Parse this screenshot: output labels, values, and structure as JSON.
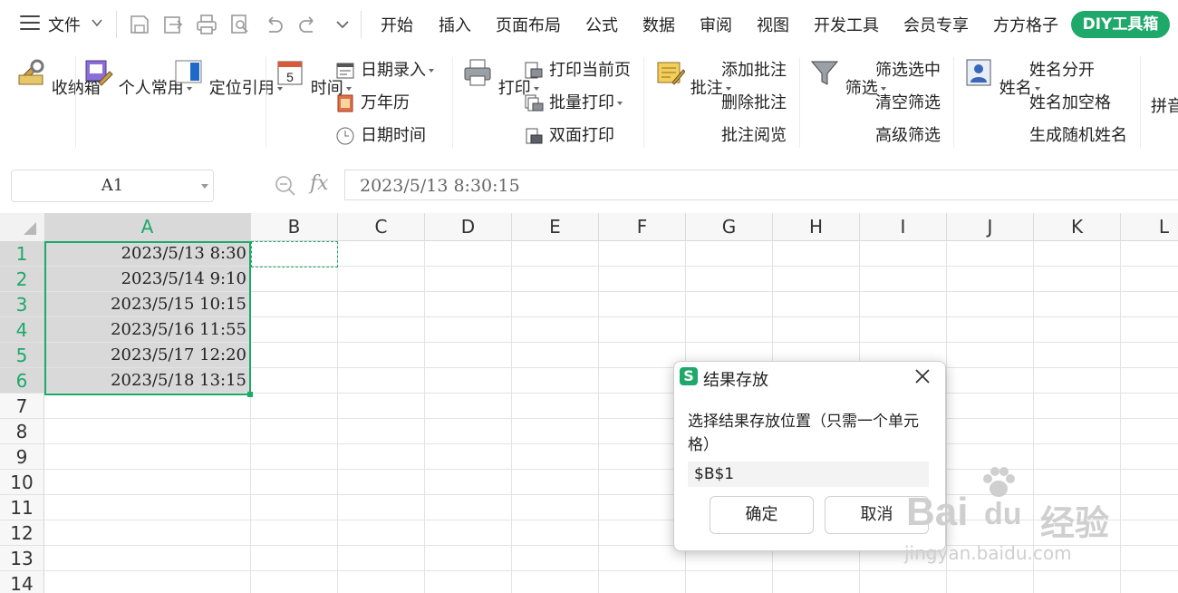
{
  "menu": {
    "file_label": "文件",
    "tabs": [
      "开始",
      "插入",
      "页面布局",
      "公式",
      "数据",
      "审阅",
      "视图",
      "开发工具",
      "会员专享",
      "方方格子"
    ],
    "diy_tab": "DIY工具箱",
    "accent_color": "#1ea86a"
  },
  "ribbon": {
    "storage": "收纳箱",
    "personal": "个人常用",
    "locate": "定位引用",
    "time": "时间",
    "date_entry": "日期录入",
    "calendar": "万年历",
    "datetime": "日期时间",
    "print": "打印",
    "print_current": "打印当前页",
    "batch_print": "批量打印",
    "duplex_print": "双面打印",
    "comment": "批注",
    "add_comment": "添加批注",
    "delete_comment": "删除批注",
    "view_comment": "批注阅览",
    "filter": "筛选",
    "filter_selected": "筛选选中",
    "clear_filter": "清空筛选",
    "advanced_filter": "高级筛选",
    "name": "姓名",
    "name_split": "姓名分开",
    "name_space": "姓名加空格",
    "random_name": "生成随机姓名",
    "pinyin": "拼音"
  },
  "formula_bar": {
    "cell_ref": "A1",
    "fx": "fx",
    "value": "2023/5/13  8:30:15"
  },
  "sheet": {
    "columns": [
      "A",
      "B",
      "C",
      "D",
      "E",
      "F",
      "G",
      "H",
      "I",
      "J",
      "K",
      "L"
    ],
    "rows": [
      "1",
      "2",
      "3",
      "4",
      "5",
      "6",
      "7",
      "8",
      "9",
      "10",
      "11",
      "12",
      "13",
      "14"
    ],
    "col_a_values": [
      "2023/5/13  8:30",
      "2023/5/14  9:10",
      "2023/5/15  10:15",
      "2023/5/16  11:55",
      "2023/5/17  12:20",
      "2023/5/18  13:15"
    ]
  },
  "dialog": {
    "logo": "S",
    "title": "结果存放",
    "prompt": "选择结果存放位置（只需一个单元格）",
    "input_value": "$B$1",
    "ok": "确定",
    "cancel": "取消"
  },
  "watermark": {
    "brand": "Bai",
    "brand_suffix": "du",
    "brand_cn": "经验",
    "url": "jingyan.baidu.com"
  }
}
